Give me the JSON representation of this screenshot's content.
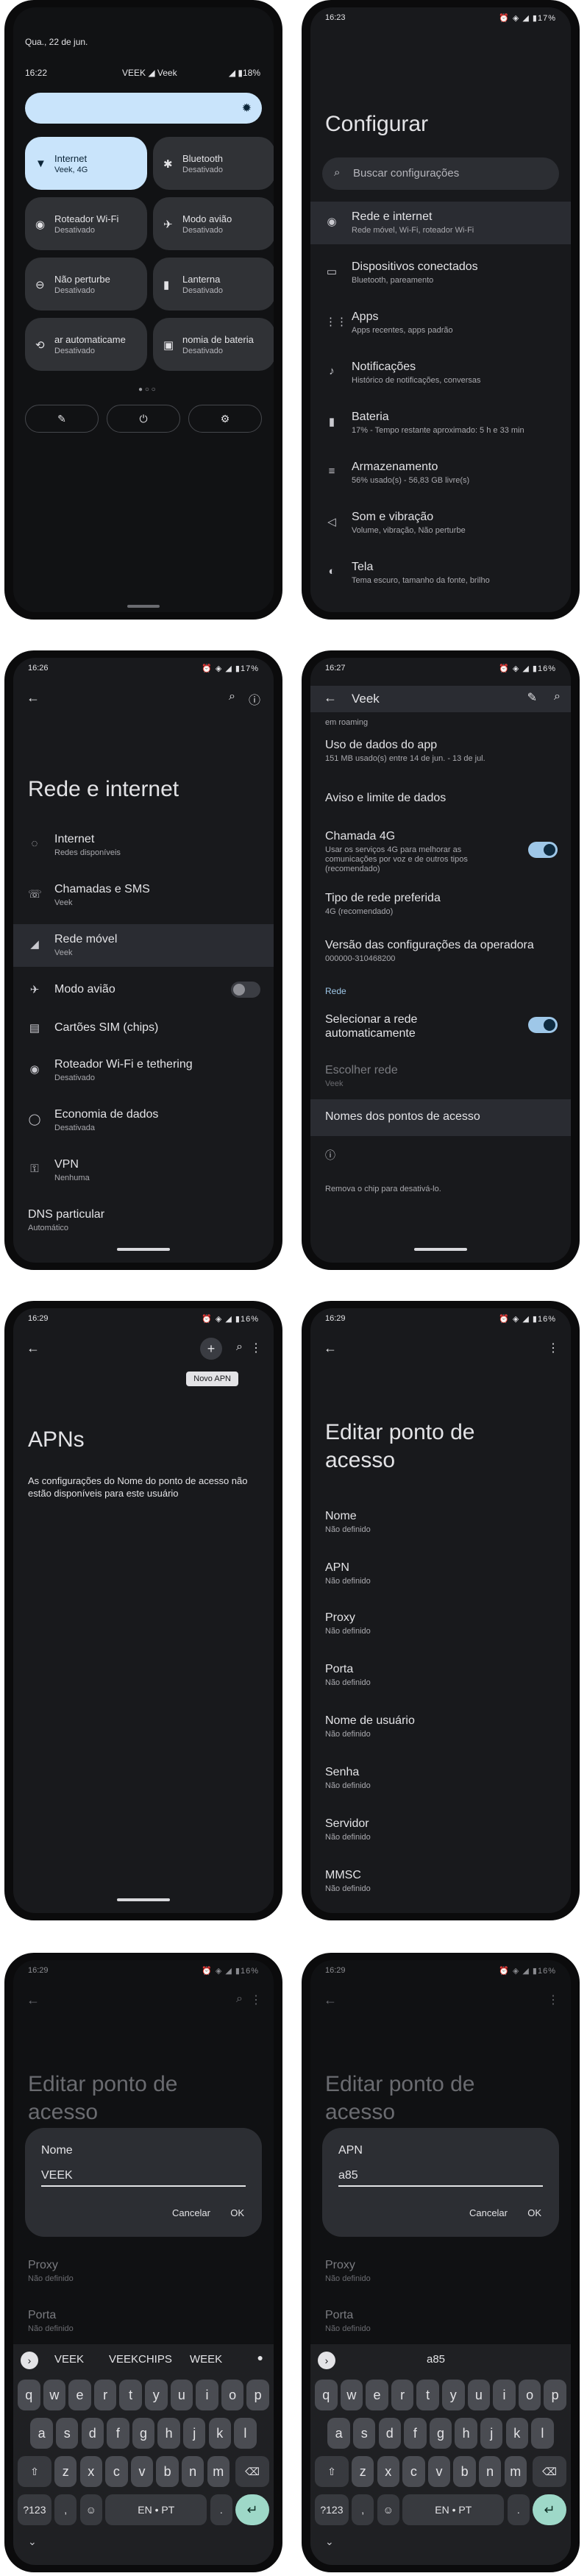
{
  "p1": {
    "date": "Qua., 22 de jun.",
    "time": "16:22",
    "carrier": "VEEK ◢ Veek",
    "status": "◢ ▮18%",
    "tiles": [
      {
        "icon": "▼",
        "title": "Internet",
        "sub": "Veek, 4G"
      },
      {
        "icon": "✱",
        "title": "Bluetooth",
        "sub": "Desativado"
      },
      {
        "icon": "◉",
        "title": "Roteador Wi-Fi",
        "sub": "Desativado"
      },
      {
        "icon": "✈",
        "title": "Modo avião",
        "sub": "Desativado"
      },
      {
        "icon": "⊖",
        "title": "Não perturbe",
        "sub": "Desativado"
      },
      {
        "icon": "▮",
        "title": "Lanterna",
        "sub": "Desativado"
      },
      {
        "icon": "⟲",
        "title": "ar automaticame",
        "sub": "Desativado"
      },
      {
        "icon": "▣",
        "title": "nomia de bateria",
        "sub": "Desativado"
      }
    ],
    "buttons": [
      "✎",
      "⏻",
      "⚙"
    ]
  },
  "p2": {
    "time": "16:23",
    "status": "⏰ ◈ ◢ ▮17%",
    "title": "Configurar",
    "search": "Buscar configurações",
    "items": [
      {
        "icon": "◉",
        "title": "Rede e internet",
        "sub": "Rede móvel, Wi-Fi, roteador Wi-Fi"
      },
      {
        "icon": "▭",
        "title": "Dispositivos conectados",
        "sub": "Bluetooth, pareamento"
      },
      {
        "icon": "⋮⋮",
        "title": "Apps",
        "sub": "Apps recentes, apps padrão"
      },
      {
        "icon": "♪",
        "title": "Notificações",
        "sub": "Histórico de notificações, conversas"
      },
      {
        "icon": "▮",
        "title": "Bateria",
        "sub": "17% - Tempo restante aproximado: 5 h e 33 min"
      },
      {
        "icon": "≡",
        "title": "Armazenamento",
        "sub": "56% usado(s) - 56,83 GB livre(s)"
      },
      {
        "icon": "◁",
        "title": "Som e vibração",
        "sub": "Volume, vibração, Não perturbe"
      },
      {
        "icon": "◐",
        "title": "Tela",
        "sub": "Tema escuro, tamanho da fonte, brilho"
      }
    ]
  },
  "p3": {
    "time": "16:26",
    "status": "⏰ ◈ ◢ ▮17%",
    "title": "Rede e internet",
    "items": [
      {
        "icon": "◌",
        "title": "Internet",
        "sub": "Redes disponíveis"
      },
      {
        "icon": "☏",
        "title": "Chamadas e SMS",
        "sub": "Veek"
      },
      {
        "icon": "◢",
        "title": "Rede móvel",
        "sub": "Veek"
      },
      {
        "icon": "✈",
        "title": "Modo avião",
        "sub": ""
      },
      {
        "icon": "▤",
        "title": "Cartões SIM (chips)",
        "sub": ""
      },
      {
        "icon": "◉",
        "title": "Roteador Wi-Fi e tethering",
        "sub": "Desativado"
      },
      {
        "icon": "◯",
        "title": "Economia de dados",
        "sub": "Desativada"
      },
      {
        "icon": "⚿",
        "title": "VPN",
        "sub": "Nenhuma"
      },
      {
        "icon": "",
        "title": "DNS particular",
        "sub": "Automático"
      }
    ]
  },
  "p4": {
    "time": "16:27",
    "status": "⏰ ◈ ◢ ▮16%",
    "title": "Veek",
    "top_fragment": "em roaming",
    "items": [
      {
        "title": "Uso de dados do app",
        "sub": "151 MB usado(s) entre 14 de jun. - 13 de jul."
      },
      {
        "title": "Aviso e limite de dados",
        "sub": ""
      },
      {
        "title": "Chamada 4G",
        "sub": "Usar os serviços 4G para melhorar as comunicações por voz e de outros tipos (recomendado)"
      },
      {
        "title": "Tipo de rede preferida",
        "sub": "4G (recomendado)"
      },
      {
        "title": "Versão das configurações da operadora",
        "sub": "000000-310468200"
      }
    ],
    "section": "Rede",
    "auto": "Selecionar a rede automaticamente",
    "choose": "Escolher rede",
    "choose_sub": "Veek",
    "apn": "Nomes dos pontos de acesso",
    "footer": "Remova o chip para desativá-lo."
  },
  "p5": {
    "time": "16:29",
    "status": "⏰ ◈ ◢ ▮16%",
    "tooltip": "Novo APN",
    "title": "APNs",
    "message": "As configurações do Nome do ponto de acesso não estão disponíveis para este usuário"
  },
  "p6": {
    "time": "16:29",
    "status": "⏰ ◈ ◢ ▮16%",
    "title": "Editar ponto de acesso",
    "fields": [
      {
        "title": "Nome",
        "sub": "Não definido"
      },
      {
        "title": "APN",
        "sub": "Não definido"
      },
      {
        "title": "Proxy",
        "sub": "Não definido"
      },
      {
        "title": "Porta",
        "sub": "Não definido"
      },
      {
        "title": "Nome de usuário",
        "sub": "Não definido"
      },
      {
        "title": "Senha",
        "sub": "Não definido"
      },
      {
        "title": "Servidor",
        "sub": "Não definido"
      },
      {
        "title": "MMSC",
        "sub": "Não definido"
      }
    ]
  },
  "p7": {
    "time": "16:29",
    "status": "⏰ ◈ ◢ ▮16%",
    "title": "Editar ponto de acesso",
    "dlg_title": "Nome",
    "dlg_value": "VEEK",
    "cancel": "Cancelar",
    "ok": "OK",
    "bg": [
      {
        "title": "Proxy",
        "sub": "Não definido"
      },
      {
        "title": "Porta",
        "sub": "Não definido"
      }
    ],
    "sugg": [
      "VEEK",
      "VEEKCHIPS",
      "WEEK"
    ]
  },
  "p8": {
    "time": "16:29",
    "status": "⏰ ◈ ◢ ▮16%",
    "title": "Editar ponto de acesso",
    "dlg_title": "APN",
    "dlg_value": "a85",
    "cancel": "Cancelar",
    "ok": "OK",
    "bg": [
      {
        "title": "Proxy",
        "sub": "Não definido"
      },
      {
        "title": "Porta",
        "sub": "Não definido"
      }
    ],
    "sugg": [
      "a85"
    ]
  },
  "keyboard": {
    "row1": [
      "q",
      "w",
      "e",
      "r",
      "t",
      "y",
      "u",
      "i",
      "o",
      "p"
    ],
    "row2": [
      "a",
      "s",
      "d",
      "f",
      "g",
      "h",
      "j",
      "k",
      "l"
    ],
    "row3": [
      "z",
      "x",
      "c",
      "v",
      "b",
      "n",
      "m"
    ],
    "shift": "⇧",
    "del": "⌫",
    "sym": "?123",
    "comma": ",",
    "emoji": "☺",
    "space": "EN • PT",
    "period": ".",
    "enter": "↵",
    "mic": "🎙",
    "expand": "›"
  }
}
